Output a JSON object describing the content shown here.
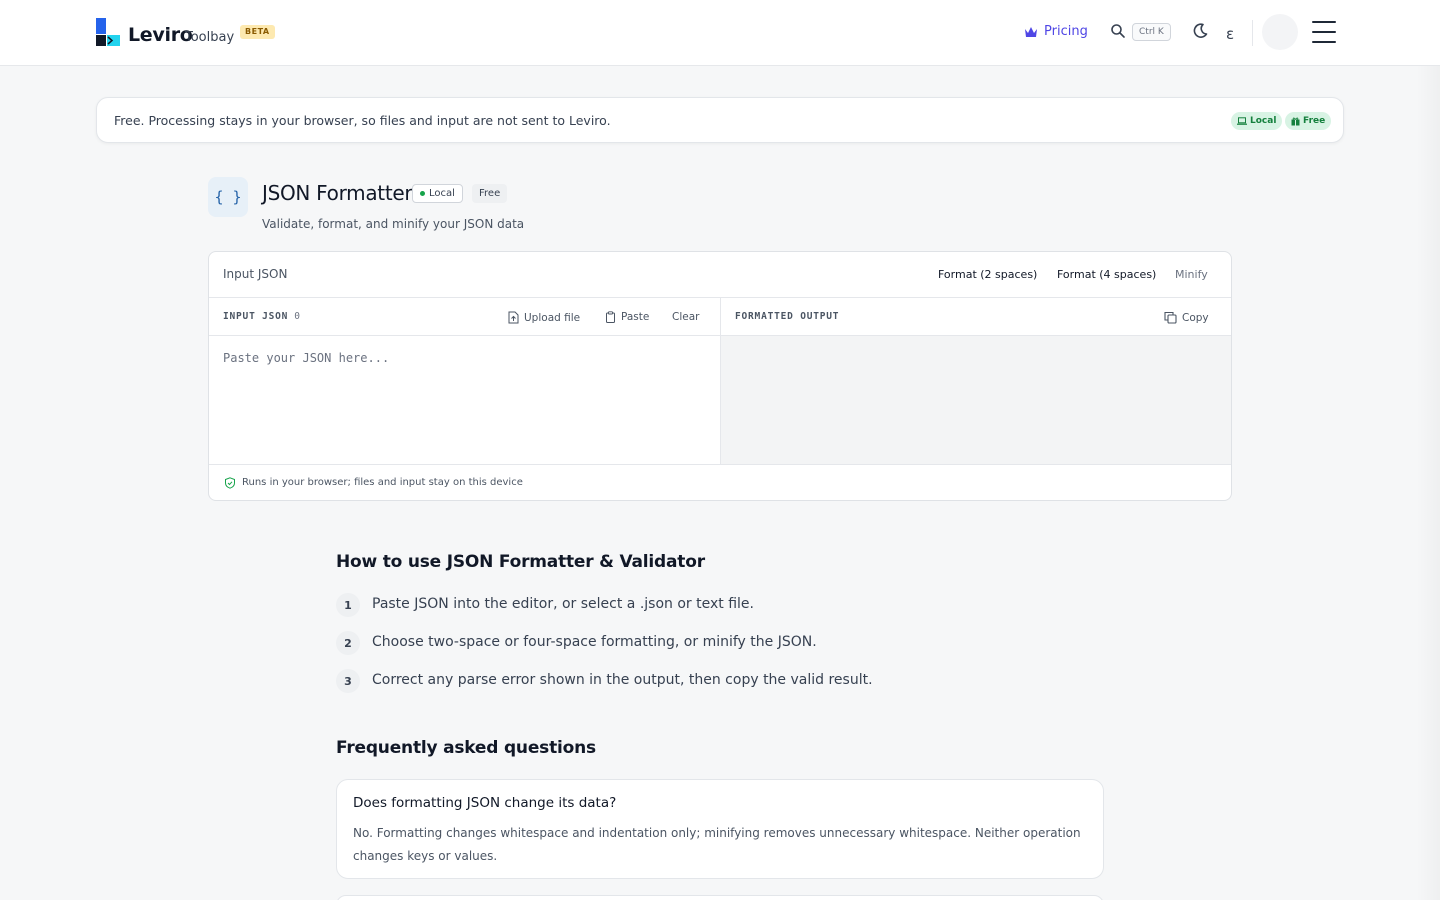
{
  "header": {
    "logo_text": "Leviro",
    "logo_sub": "Toolbay",
    "beta": "BETA",
    "pricing": "Pricing",
    "shortcut": "Ctrl K",
    "lang": "ε"
  },
  "notice": {
    "text": "Free. Processing stays in your browser, so files and input are not sent to Leviro.",
    "local": "Local",
    "free": "Free"
  },
  "tool": {
    "icon": "{ }",
    "title": "JSON Formatter",
    "tag_local": "Local",
    "tag_free": "Free",
    "description": "Validate, format, and minify your JSON data"
  },
  "editor": {
    "top_label": "Input JSON",
    "format2": "Format (2 spaces)",
    "format4": "Format (4 spaces)",
    "minify": "Minify",
    "input_label": "INPUT JSON",
    "input_count": "0",
    "upload": "Upload file",
    "paste": "Paste",
    "clear": "Clear",
    "output_label": "FORMATTED OUTPUT",
    "copy": "Copy",
    "placeholder": "Paste your JSON here...",
    "footer": "Runs in your browser; files and input stay on this device"
  },
  "howto": {
    "title": "How to use JSON Formatter & Validator",
    "steps": [
      {
        "n": "1",
        "text": "Paste JSON into the editor, or select a .json or text file."
      },
      {
        "n": "2",
        "text": "Choose two-space or four-space formatting, or minify the JSON."
      },
      {
        "n": "3",
        "text": "Correct any parse error shown in the output, then copy the valid result."
      }
    ]
  },
  "faq": {
    "title": "Frequently asked questions",
    "items": [
      {
        "q": "Does formatting JSON change its data?",
        "a": "No. Formatting changes whitespace and indentation only; minifying removes unnecessary whitespace. Neither operation changes keys or values."
      }
    ]
  },
  "colors": {
    "accent": "#4f46e5",
    "logo_blue": "#2563eb",
    "logo_cyan": "#22d3ee",
    "local_green": "#16a34a"
  }
}
